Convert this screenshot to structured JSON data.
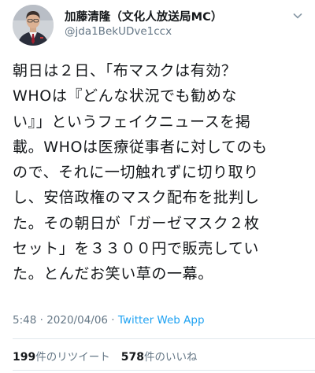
{
  "tweet": {
    "author": {
      "display_name": "加藤清隆（文化人放送局MC）",
      "handle": "@jda1BekUDve1ccx"
    },
    "body_lines": [
      "朝日は２日、「布マスクは有効？",
      "WHOは『どんな状況でも勧めな",
      "い』」というフェイクニュースを掲",
      "載。WHOは医療従事者に対してのも",
      "ので、それに一切触れずに切り取り",
      "し、安倍政権のマスク配布を批判し",
      "た。その朝日が「ガーゼマスク２枚",
      "セット」を３３００円で販売してい",
      "た。とんだお笑い草の一幕。"
    ],
    "time": "5:48",
    "separator": " · ",
    "date": "2020/04/06",
    "source": "Twitter Web App",
    "retweets": {
      "count": "199",
      "label": "件のリツイート"
    },
    "likes": {
      "count": "578",
      "label": "件のいいね"
    }
  },
  "icons": {
    "avatar": "avatar-photo",
    "menu": "chevron-down-icon"
  },
  "colors": {
    "text": "#14171a",
    "secondary": "#657786",
    "link": "#1da1f2",
    "divider": "#e1e8ed"
  }
}
